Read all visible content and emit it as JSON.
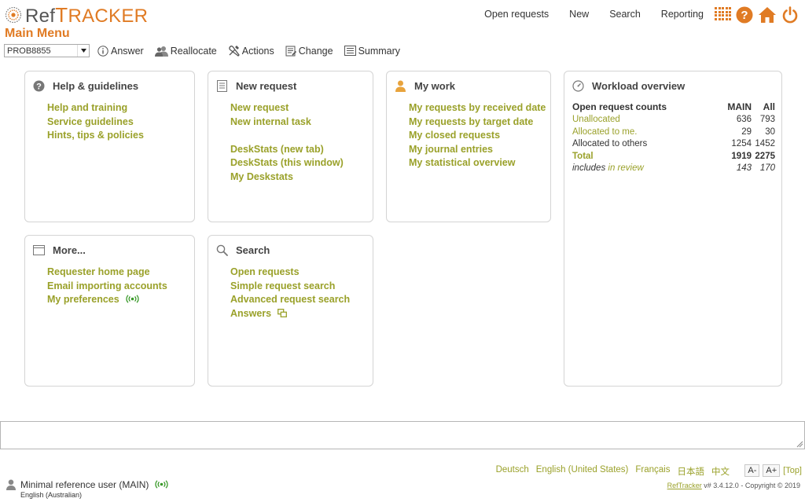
{
  "header": {
    "logo": {
      "ref": "Ref",
      "t": "T",
      "racker": "RACKER"
    },
    "page_title": "Main Menu",
    "nav": [
      "Open requests",
      "New",
      "Search",
      "Reporting"
    ]
  },
  "toolbar": {
    "problem_select_value": "PROB8855",
    "answer": "Answer",
    "reallocate": "Reallocate",
    "actions": "Actions",
    "change": "Change",
    "summary": "Summary"
  },
  "panels": {
    "help": {
      "title": "Help & guidelines",
      "links": [
        "Help and training",
        "Service guidelines",
        "Hints, tips & policies"
      ]
    },
    "new_request": {
      "title": "New request",
      "links_a": [
        "New request",
        "New internal task"
      ],
      "links_b": [
        "DeskStats (new tab)",
        "DeskStats (this window)",
        "My Deskstats"
      ]
    },
    "my_work": {
      "title": "My work",
      "links": [
        "My requests by received date",
        "My requests by target date",
        "My closed requests",
        "My journal entries",
        "My statistical overview"
      ]
    },
    "workload": {
      "title": "Workload overview",
      "header": {
        "label": "Open request counts",
        "main": "MAIN",
        "all": "All"
      },
      "rows": [
        {
          "label": "Unallocated",
          "main": "636",
          "all": "793"
        },
        {
          "label": "Allocated to me.",
          "main": "29",
          "all": "30"
        },
        {
          "label": "Allocated to others",
          "main": "1254",
          "all": "1452"
        },
        {
          "label": "Total",
          "main": "1919",
          "all": "2275"
        }
      ],
      "review": {
        "prefix": "includes",
        "link": "in review",
        "main": "143",
        "all": "170"
      }
    },
    "more": {
      "title": "More...",
      "links": [
        "Requester home page",
        "Email importing accounts",
        "My preferences"
      ]
    },
    "search": {
      "title": "Search",
      "links": [
        "Open requests",
        "Simple request search",
        "Advanced request search",
        "Answers"
      ]
    }
  },
  "footer": {
    "languages": [
      "Deutsch",
      "English (United States)",
      "Français",
      "日本語",
      "中文"
    ],
    "font_smaller": "A-",
    "font_larger": "A+",
    "top_link": "[Top]",
    "version_link": "RefTracker",
    "version_text": " v# 3.4.12.0 - Copyright © 2019",
    "user_name": "Minimal reference user (MAIN)",
    "user_lang": "English (Australian)"
  },
  "colors": {
    "accent": "#e07b24",
    "link": "#9aa12a",
    "border": "#d4d4d4"
  }
}
